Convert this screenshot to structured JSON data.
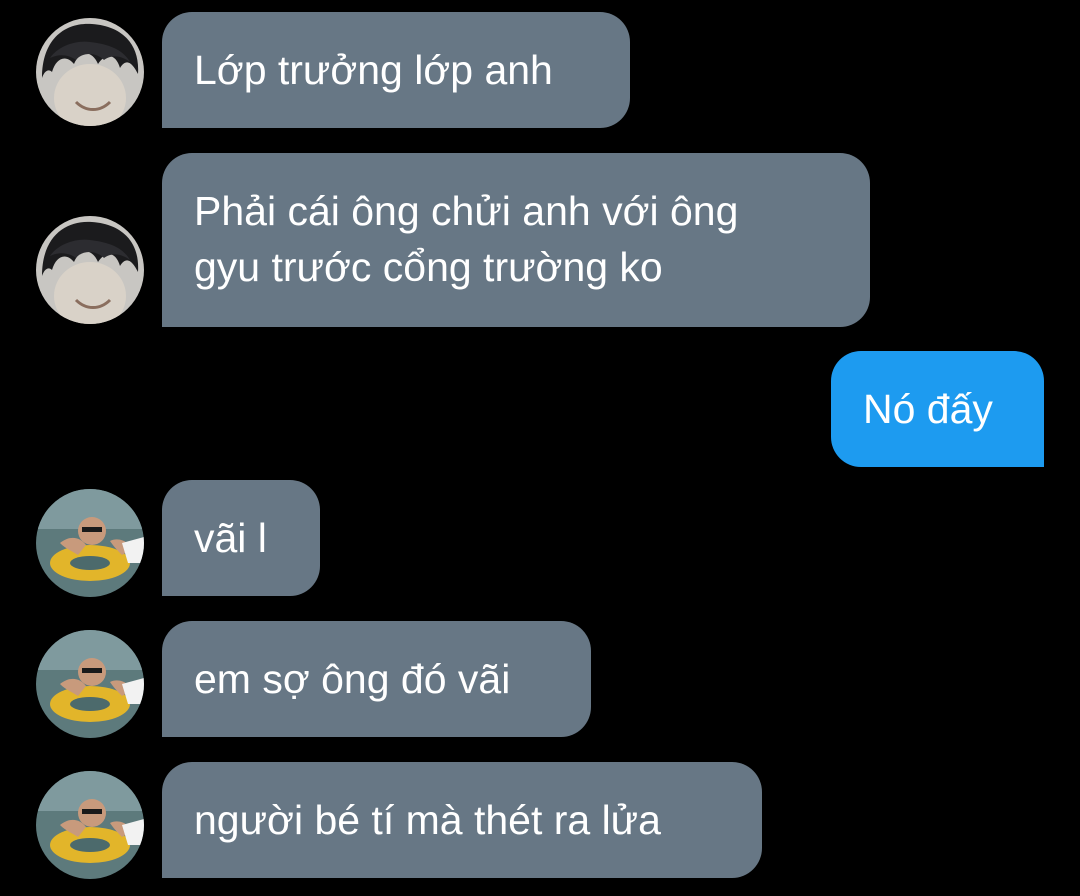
{
  "conversation": {
    "messages": [
      {
        "sender": "contact_1",
        "direction": "incoming",
        "text": "Lớp trưởng lớp anh"
      },
      {
        "sender": "contact_1",
        "direction": "incoming",
        "lines": [
          "Phải cái ông chửi anh với ông",
          "gyu trước cổng trường ko"
        ]
      },
      {
        "sender": "me",
        "direction": "outgoing",
        "text": "Nó đấy"
      },
      {
        "sender": "contact_2",
        "direction": "incoming",
        "text": "vãi l"
      },
      {
        "sender": "contact_2",
        "direction": "incoming",
        "text": "em sợ ông đó vãi"
      },
      {
        "sender": "contact_2",
        "direction": "incoming",
        "text": "người bé tí mà thét ra lửa"
      }
    ]
  },
  "colors": {
    "background": "#000000",
    "incoming_bubble": "#677785",
    "outgoing_bubble": "#1d9bf0",
    "text": "#ffffff"
  },
  "icons": {
    "avatar_contact_1": "avatar-dark-hair-photo-icon",
    "avatar_contact_2": "avatar-swim-ring-photo-icon"
  }
}
